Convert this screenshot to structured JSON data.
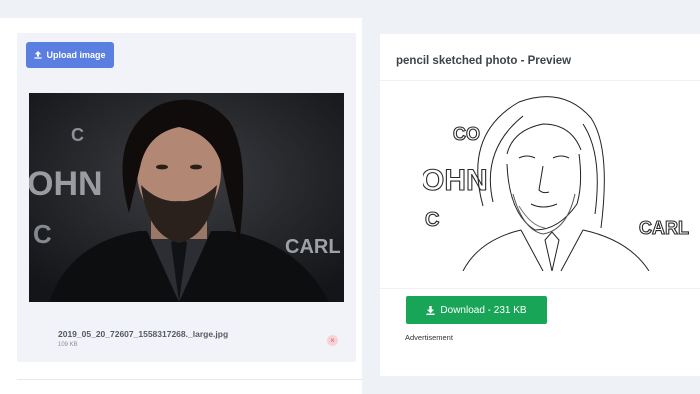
{
  "upload": {
    "button_label": "Upload image",
    "file_name": "2019_05_20_72607_1558317268._large.jpg",
    "file_size": "109 KB",
    "remove_glyph": "×"
  },
  "preview": {
    "title": "pencil sketched photo - Preview",
    "download_label": "Download - 231 KB",
    "ad_label": "Advertisement"
  },
  "backdrop_text": {
    "left_lines": [
      "C",
      "OHN",
      "C"
    ],
    "right_text": "CARL",
    "sketch_lines": [
      "CO",
      "OHN",
      "C"
    ],
    "sketch_right": "CARL"
  },
  "icons": {
    "upload": "upload-icon",
    "download": "download-icon",
    "remove": "close-icon"
  },
  "colors": {
    "upload_button": "#5a7fe0",
    "download_button": "#18a558",
    "remove_button": "#f7d3d6"
  }
}
